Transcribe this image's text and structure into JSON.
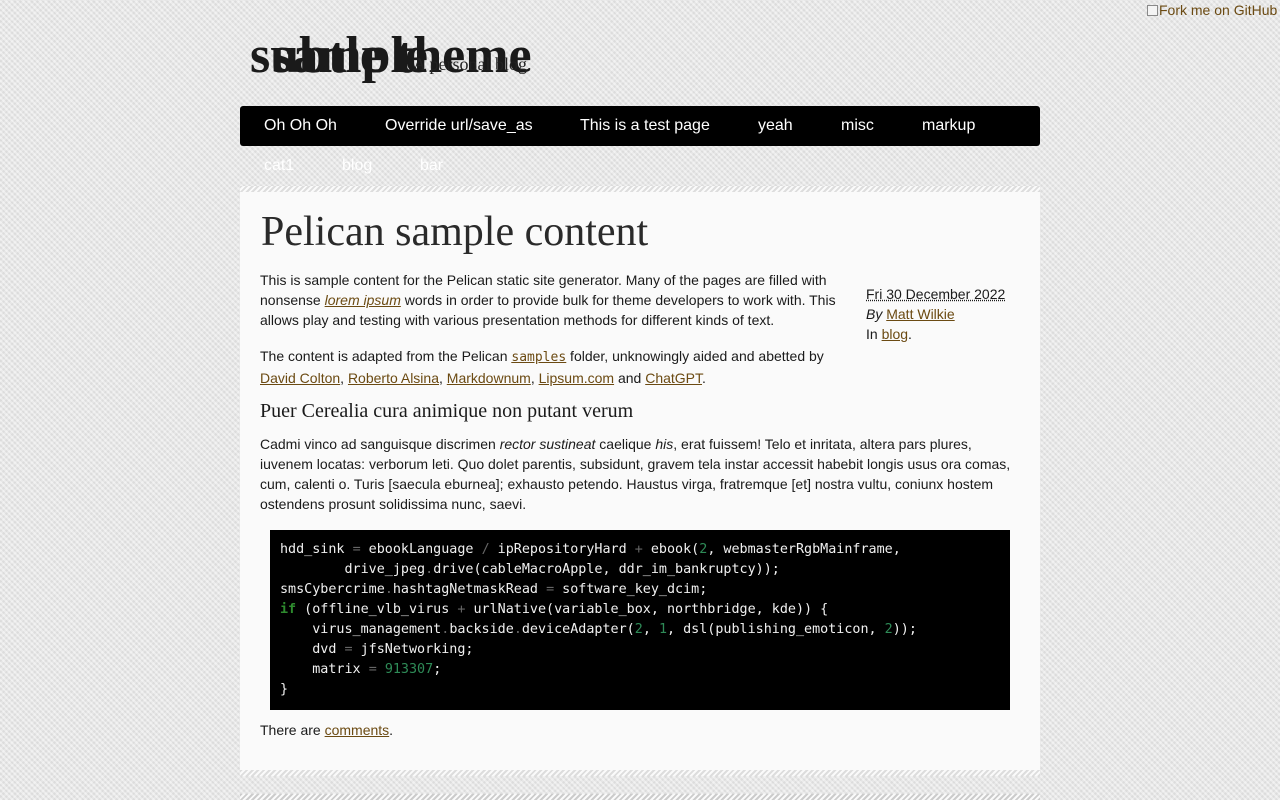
{
  "fork_ribbon": {
    "alt_text": "Fork me on GitHub"
  },
  "site": {
    "title": "subtle theme",
    "title_overlap": "sample",
    "subtitle": "A personal blog."
  },
  "menu": [
    {
      "label": "Oh Oh Oh"
    },
    {
      "label": "Override url/save_as"
    },
    {
      "label": "This is a test page"
    },
    {
      "label": "yeah"
    },
    {
      "label": "misc"
    },
    {
      "label": "markup"
    }
  ],
  "categories": [
    {
      "label": "cat1"
    },
    {
      "label": "blog"
    },
    {
      "label": "bar"
    }
  ],
  "article": {
    "title": "Pelican sample content",
    "meta": {
      "date": "Fri 30 December 2022",
      "by": "By",
      "author": "Matt Wilkie",
      "in": "In",
      "category": "blog",
      "period": "."
    },
    "p1": {
      "t1": "This is sample content for the Pelican static site generator. Many of the pages are filled with nonsense ",
      "link": "lorem ipsum",
      "t2": " words in order to provide bulk for theme developers to work with. This allows play and testing with various presentation methods for different kinds of text."
    },
    "p2": {
      "t1": "The content is adapted from the Pelican ",
      "code": "samples",
      "t2": " folder, unknowingly aided and abetted by ",
      "links": [
        "David Colton",
        "Roberto Alsina",
        "Markdownum",
        "Lipsum.com",
        "ChatGPT"
      ],
      "sep": ", ",
      "and": " and ",
      "end": "."
    },
    "section_heading": "Puer Cerealia cura animique non putant verum",
    "p3": {
      "t1": "Cadmi vinco ad sanguisque discrimen ",
      "em1": "rector sustineat",
      "t2": " caelique ",
      "em2": "his",
      "t3": ", erat fuissem! Telo et inritata, altera pars plures, iuvenem locatas: verborum leti. Quo dolet parentis, subsidunt, gravem tela instar accessit habebit longis usus ora comas, cum, calenti o. Turis [saecula eburnea]; exhausto petendo. Haustus virga, fratremque [et] nostra vultu, coniunx hostem ostendens prosunt solidissima nunc, saevi."
    },
    "code_lines": [
      "hdd_sink = ebookLanguage / ipRepositoryHard + ebook(2, webmasterRgbMainframe,",
      "        drive_jpeg.drive(cableMacroApple, ddr_im_bankruptcy));",
      "smsCybercrime.hashtagNetmaskRead = software_key_dcim;",
      "if (offline_vlb_virus + urlNative(variable_box, northbridge, kde)) {",
      "    virus_management.backside.deviceAdapter(2, 1, dsl(publishing_emoticon, 2));",
      "    dvd = jfsNetworking;",
      "    matrix = 913307;",
      "}"
    ],
    "p4": {
      "t1": "There are ",
      "link": "comments",
      "end": "."
    }
  }
}
